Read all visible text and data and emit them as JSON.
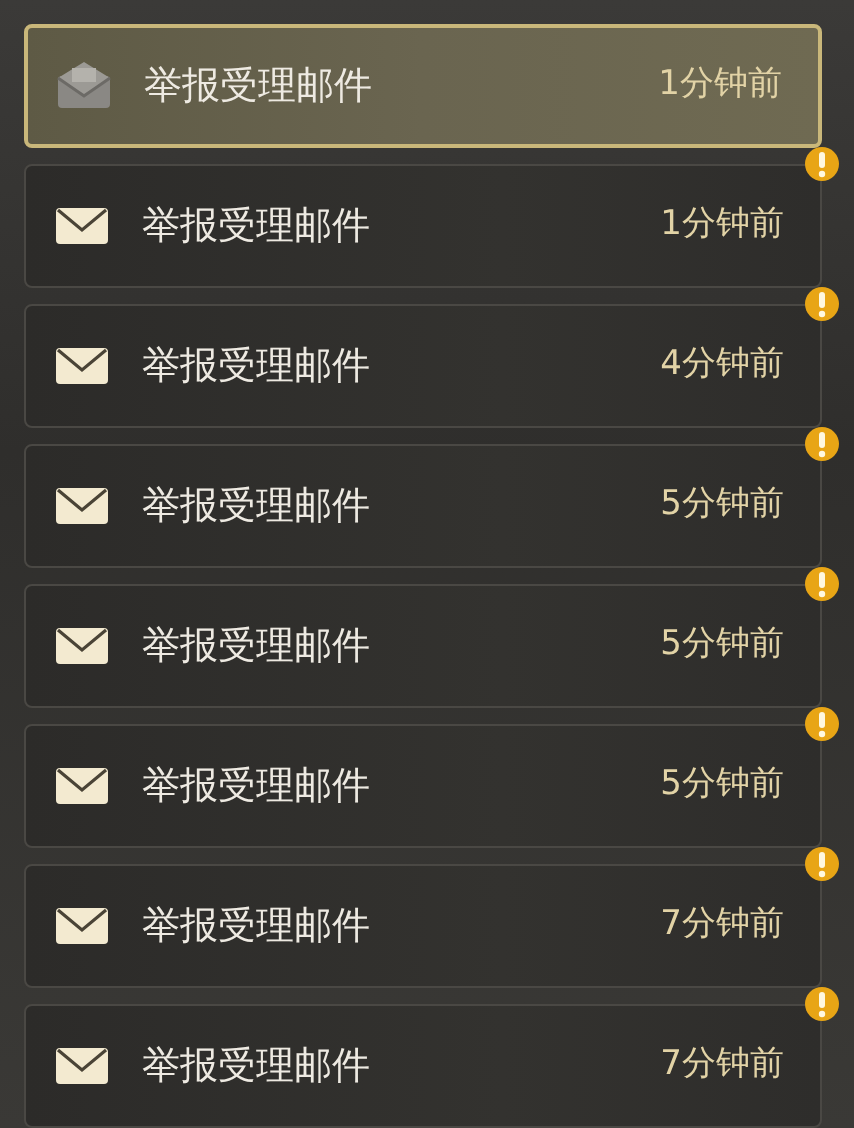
{
  "mails": [
    {
      "title": "举报受理邮件",
      "time": "1分钟前",
      "selected": true,
      "read": true
    },
    {
      "title": "举报受理邮件",
      "time": "1分钟前",
      "selected": false,
      "read": false
    },
    {
      "title": "举报受理邮件",
      "time": "4分钟前",
      "selected": false,
      "read": false
    },
    {
      "title": "举报受理邮件",
      "time": "5分钟前",
      "selected": false,
      "read": false
    },
    {
      "title": "举报受理邮件",
      "time": "5分钟前",
      "selected": false,
      "read": false
    },
    {
      "title": "举报受理邮件",
      "time": "5分钟前",
      "selected": false,
      "read": false
    },
    {
      "title": "举报受理邮件",
      "time": "7分钟前",
      "selected": false,
      "read": false
    },
    {
      "title": "举报受理邮件",
      "time": "7分钟前",
      "selected": false,
      "read": false
    }
  ]
}
